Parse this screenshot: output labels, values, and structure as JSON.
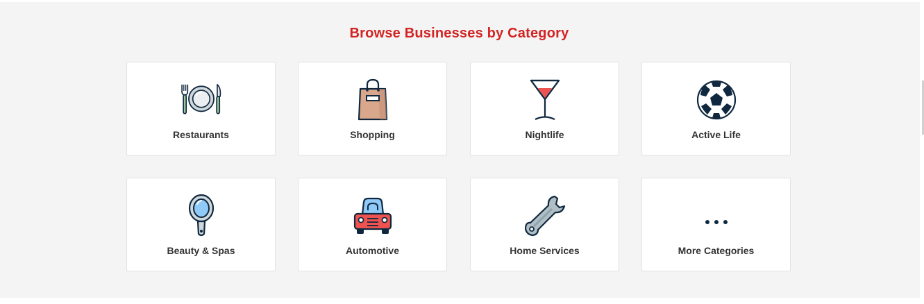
{
  "section": {
    "title": "Browse Businesses by Category"
  },
  "colors": {
    "title": "#d32323",
    "background": "#f4f4f4",
    "card": "#ffffff",
    "card_border": "#e2e2e2",
    "icon_outline": "#10283f"
  },
  "categories": [
    {
      "label": "Restaurants",
      "icon": "plate-fork-knife-icon"
    },
    {
      "label": "Shopping",
      "icon": "shopping-bag-icon"
    },
    {
      "label": "Nightlife",
      "icon": "cocktail-glass-icon"
    },
    {
      "label": "Active Life",
      "icon": "soccer-ball-icon"
    },
    {
      "label": "Beauty & Spas",
      "icon": "hand-mirror-icon"
    },
    {
      "label": "Automotive",
      "icon": "car-icon"
    },
    {
      "label": "Home Services",
      "icon": "wrench-icon"
    },
    {
      "label": "More Categories",
      "icon": "more-dots-icon"
    }
  ]
}
